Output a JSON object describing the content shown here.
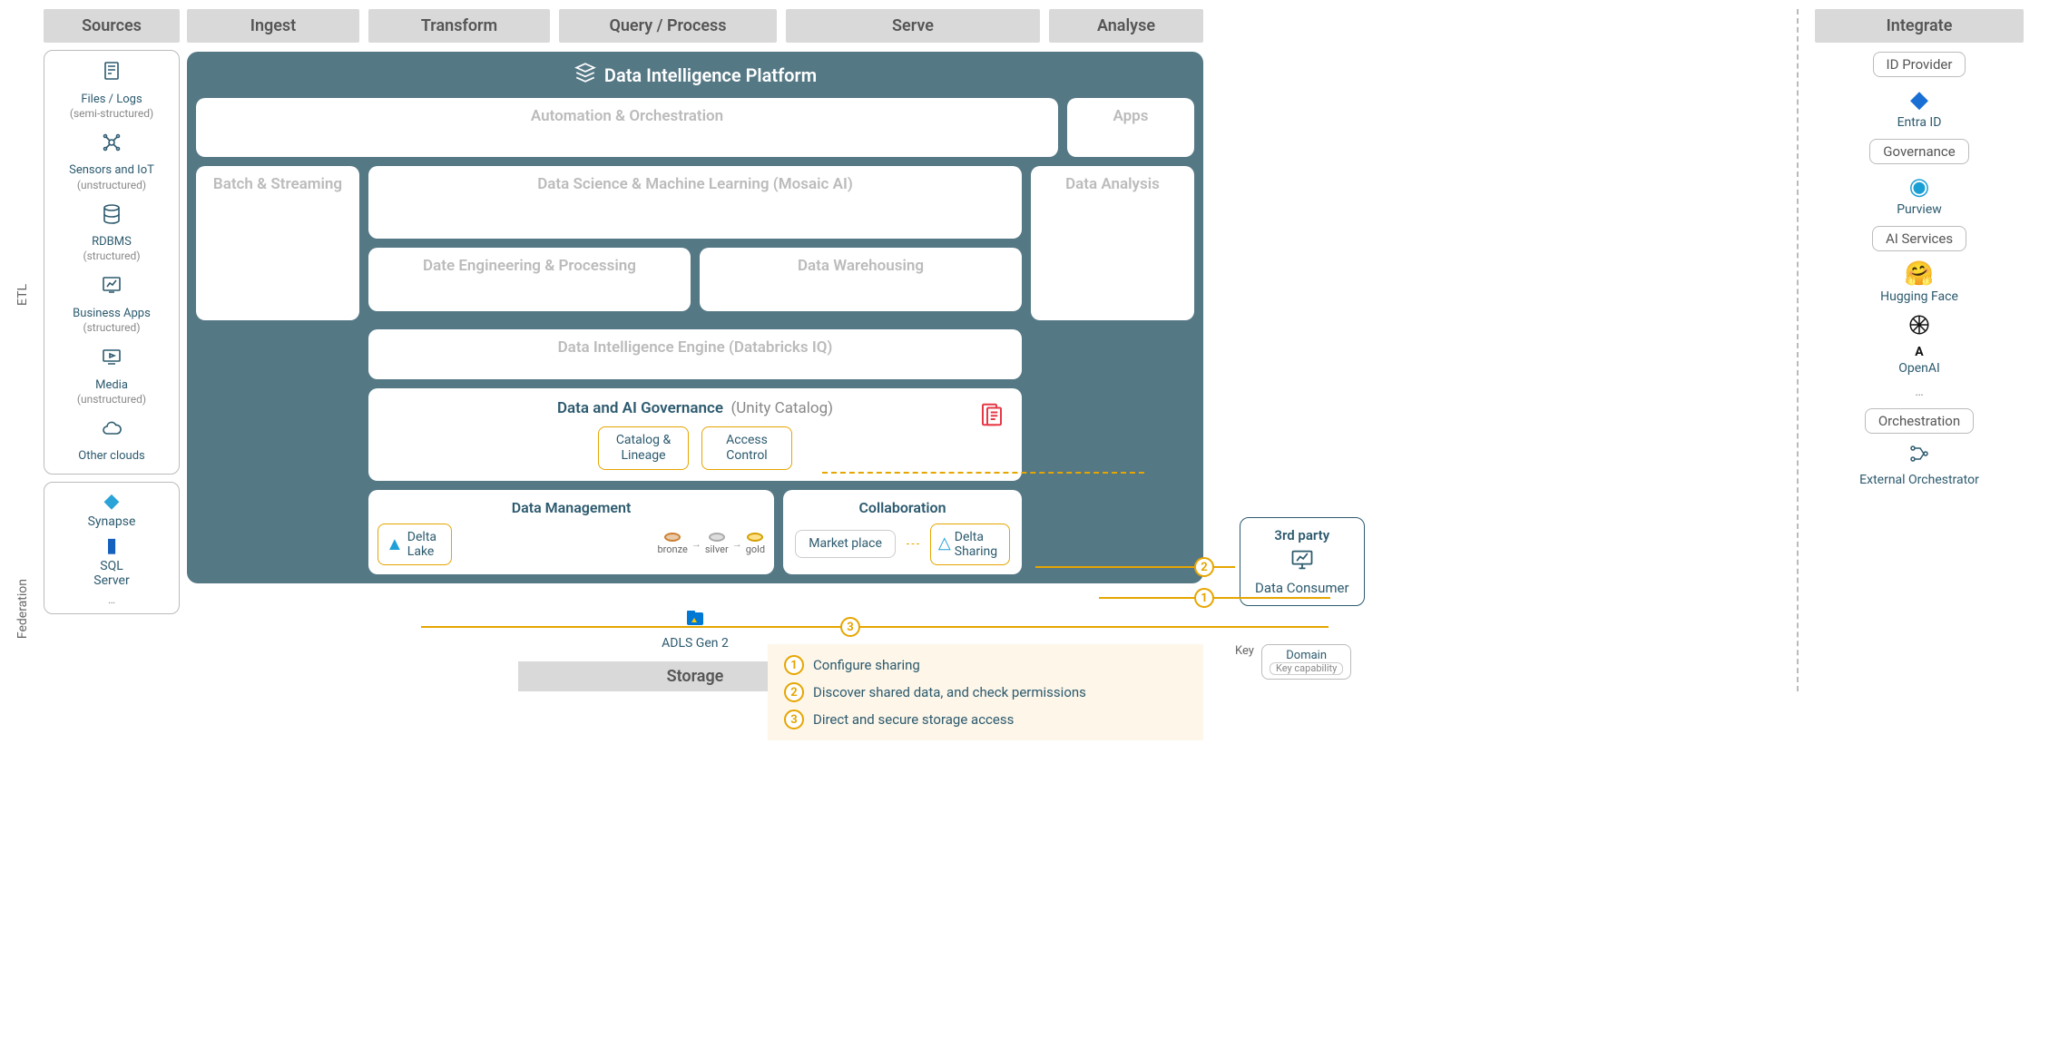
{
  "vertical": {
    "etl": "ETL",
    "federation": "Federation"
  },
  "columns": [
    "Sources",
    "Ingest",
    "Transform",
    "Query / Process",
    "Serve",
    "Analyse"
  ],
  "sources_header": "Sources",
  "sources": [
    {
      "label": "Files / Logs",
      "sub": "(semi-structured)",
      "icon": "file"
    },
    {
      "label": "Sensors and IoT",
      "sub": "(unstructured)",
      "icon": "iot"
    },
    {
      "label": "RDBMS",
      "sub": "(structured)",
      "icon": "db"
    },
    {
      "label": "Business Apps",
      "sub": "(structured)",
      "icon": "chart"
    },
    {
      "label": "Media",
      "sub": "(unstructured)",
      "icon": "media"
    },
    {
      "label": "Other clouds",
      "sub": "",
      "icon": "cloud"
    }
  ],
  "federation": {
    "items": [
      "Synapse",
      "SQL Server",
      "…"
    ]
  },
  "platform": {
    "title": "Data Intelligence Platform",
    "automation": "Automation & Orchestration",
    "apps": "Apps",
    "batch": "Batch & Streaming",
    "dsml": "Data Science & Machine Learning  (Mosaic AI)",
    "data_analysis": "Data Analysis",
    "de": "Date Engineering & Processing",
    "dw": "Data Warehousing",
    "engine": "Data Intelligence Engine  (Databricks IQ)",
    "governance_title": "Data and AI Governance",
    "governance_suffix": "(Unity Catalog)",
    "catalog_lineage": "Catalog & Lineage",
    "access_control": "Access Control",
    "data_management": "Data Management",
    "delta_lake": "Delta Lake",
    "medallion": {
      "bronze": "bronze",
      "silver": "silver",
      "gold": "gold"
    },
    "collaboration": "Collaboration",
    "marketplace": "Market place",
    "delta_sharing": "Delta Sharing"
  },
  "third_party": {
    "title": "3rd party",
    "consumer": "Data Consumer"
  },
  "storage": {
    "adls": "ADLS Gen 2",
    "label": "Storage"
  },
  "steps": [
    {
      "n": "1",
      "text": "Configure sharing"
    },
    {
      "n": "2",
      "text": "Discover shared data, and check permissions"
    },
    {
      "n": "3",
      "text": "Direct and secure storage access"
    }
  ],
  "key": {
    "label": "Key",
    "domain": "Domain",
    "capability": "Key capability"
  },
  "integrate": {
    "header": "Integrate",
    "sections": [
      {
        "chip": "ID Provider",
        "items": [
          {
            "name": "Entra ID",
            "color": "#1a6fd4"
          }
        ]
      },
      {
        "chip": "Governance",
        "items": [
          {
            "name": "Purview",
            "color": "#1a9fd4"
          }
        ]
      },
      {
        "chip": "AI Services",
        "items": [
          {
            "name": "Hugging Face",
            "color": "#ffbf00"
          },
          {
            "name": "OpenAI",
            "color": "#111"
          },
          {
            "name": "…",
            "color": "#888"
          }
        ]
      },
      {
        "chip": "Orchestration",
        "items": [
          {
            "name": "External Orchestrator",
            "color": "#2c5a6e"
          }
        ]
      }
    ]
  },
  "connector_labels": {
    "n1": "1",
    "n2": "2",
    "n3": "3"
  }
}
